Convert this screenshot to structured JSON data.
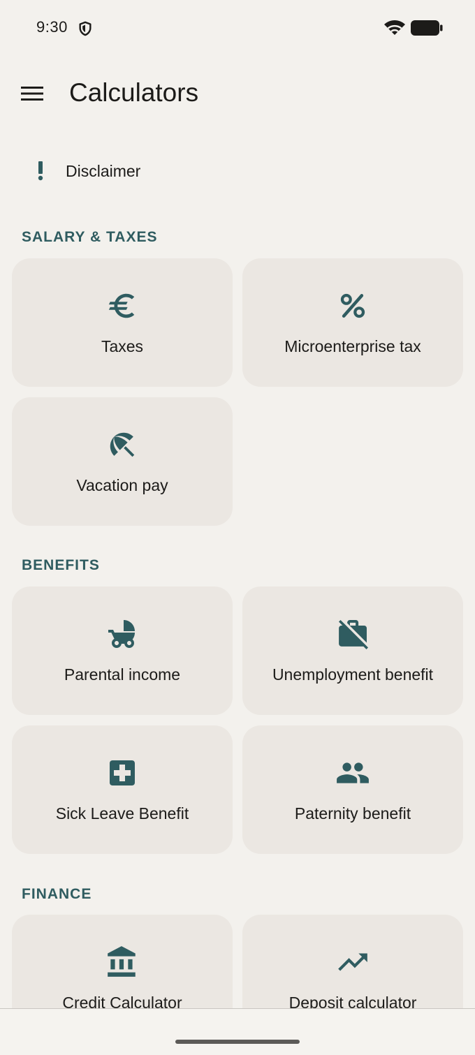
{
  "status_bar": {
    "time": "9:30"
  },
  "app_bar": {
    "title": "Calculators"
  },
  "disclaimer": {
    "label": "Disclaimer"
  },
  "sections": {
    "salary": {
      "header": "SALARY & TAXES",
      "items": [
        {
          "label": "Taxes",
          "icon": "euro-icon"
        },
        {
          "label": "Microenterprise tax",
          "icon": "percent-icon"
        },
        {
          "label": "Vacation pay",
          "icon": "beach-umbrella-icon"
        }
      ]
    },
    "benefits": {
      "header": "BENEFITS",
      "items": [
        {
          "label": "Parental income",
          "icon": "stroller-icon"
        },
        {
          "label": "Unemployment benefit",
          "icon": "work-off-icon"
        },
        {
          "label": "Sick Leave Benefit",
          "icon": "medical-cross-icon"
        },
        {
          "label": "Paternity benefit",
          "icon": "people-icon"
        }
      ]
    },
    "finance": {
      "header": "FINANCE",
      "items": [
        {
          "label": "Credit Calculator",
          "icon": "bank-icon"
        },
        {
          "label": "Deposit calculator",
          "icon": "trending-up-icon"
        }
      ]
    }
  },
  "colors": {
    "background": "#f3f1ed",
    "card": "#ebe7e2",
    "accent": "#2f5c60",
    "text": "#1c1b19"
  }
}
